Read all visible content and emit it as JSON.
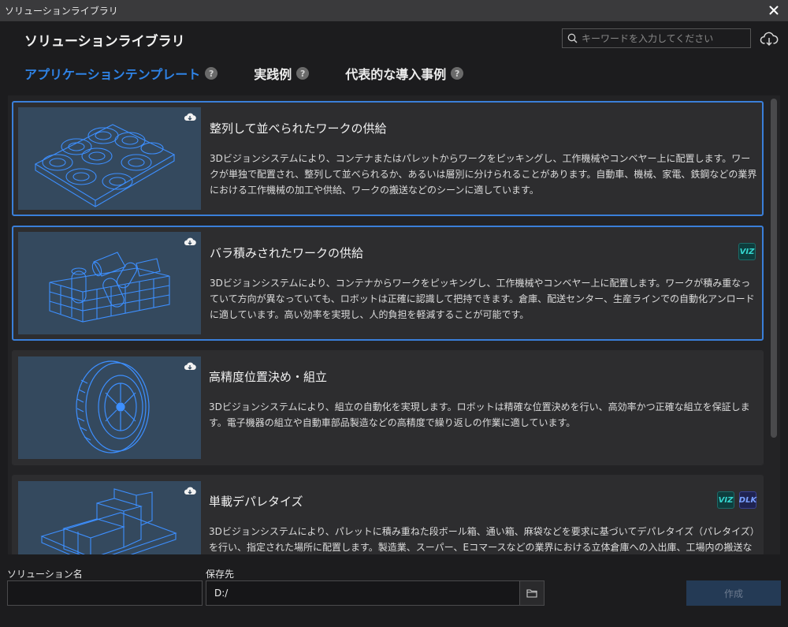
{
  "window": {
    "title": "ソリューションライブラリ"
  },
  "header": {
    "title": "ソリューションライブラリ",
    "search_placeholder": "キーワードを入力してください"
  },
  "tabs": [
    {
      "label": "アプリケーションテンプレート",
      "help": "?"
    },
    {
      "label": "実践例",
      "help": "?"
    },
    {
      "label": "代表的な導入事例",
      "help": "?"
    }
  ],
  "cards": [
    {
      "title": "整列して並べられたワークの供給",
      "description": "3Dビジョンシステムにより、コンテナまたはパレットからワークをピッキングし、工作機械やコンベヤー上に配置します。ワークが単独で配置され、整列して並べられるか、あるいは層別に分けられることがあります。自動車、機械、家電、鉄鋼などの業界における工作機械の加工や供給、ワークの搬送などのシーンに適しています。",
      "thumbnail_icon": "stacked-rings-icon",
      "badges": []
    },
    {
      "title": "バラ積みされたワークの供給",
      "description": "3Dビジョンシステムにより、コンテナからワークをピッキングし、工作機械やコンベヤー上に配置します。ワークが積み重なっていて方向が異なっていても、ロボットは正確に認識して把持できます。倉庫、配送センター、生産ラインでの自動化アンロードに適しています。高い効率を実現し、人的負担を軽減することが可能です。",
      "thumbnail_icon": "bin-cylinders-icon",
      "badges": [
        "VIZ"
      ]
    },
    {
      "title": "高精度位置決め・組立",
      "description": "3Dビジョンシステムにより、組立の自動化を実現します。ロボットは精確な位置決めを行い、高効率かつ正確な組立を保証します。電子機器の組立や自動車部品製造などの高精度で繰り返しの作業に適しています。",
      "thumbnail_icon": "tire-icon",
      "badges": []
    },
    {
      "title": "単載デパレタイズ",
      "description": "3Dビジョンシステムにより、パレットに積み重ねた段ボール箱、通い箱、麻袋などを要求に基づいてデパレタイズ（パレタイズ）を行い、指定された場所に配置します。製造業、スーパー、Eコマースなどの業界における立体倉庫への入出庫、工場内の搬送などのシーンに適しています。",
      "thumbnail_icon": "pallet-boxes-icon",
      "badges": [
        "VIZ",
        "DLK"
      ]
    }
  ],
  "footer": {
    "name_label": "ソリューション名",
    "name_value": "",
    "path_label": "保存先",
    "path_value": "D:/",
    "create_label": "作成"
  },
  "colors": {
    "accent": "#2f83e6",
    "selected_border": "#3a7fd9",
    "wire": "#3d8fff"
  }
}
